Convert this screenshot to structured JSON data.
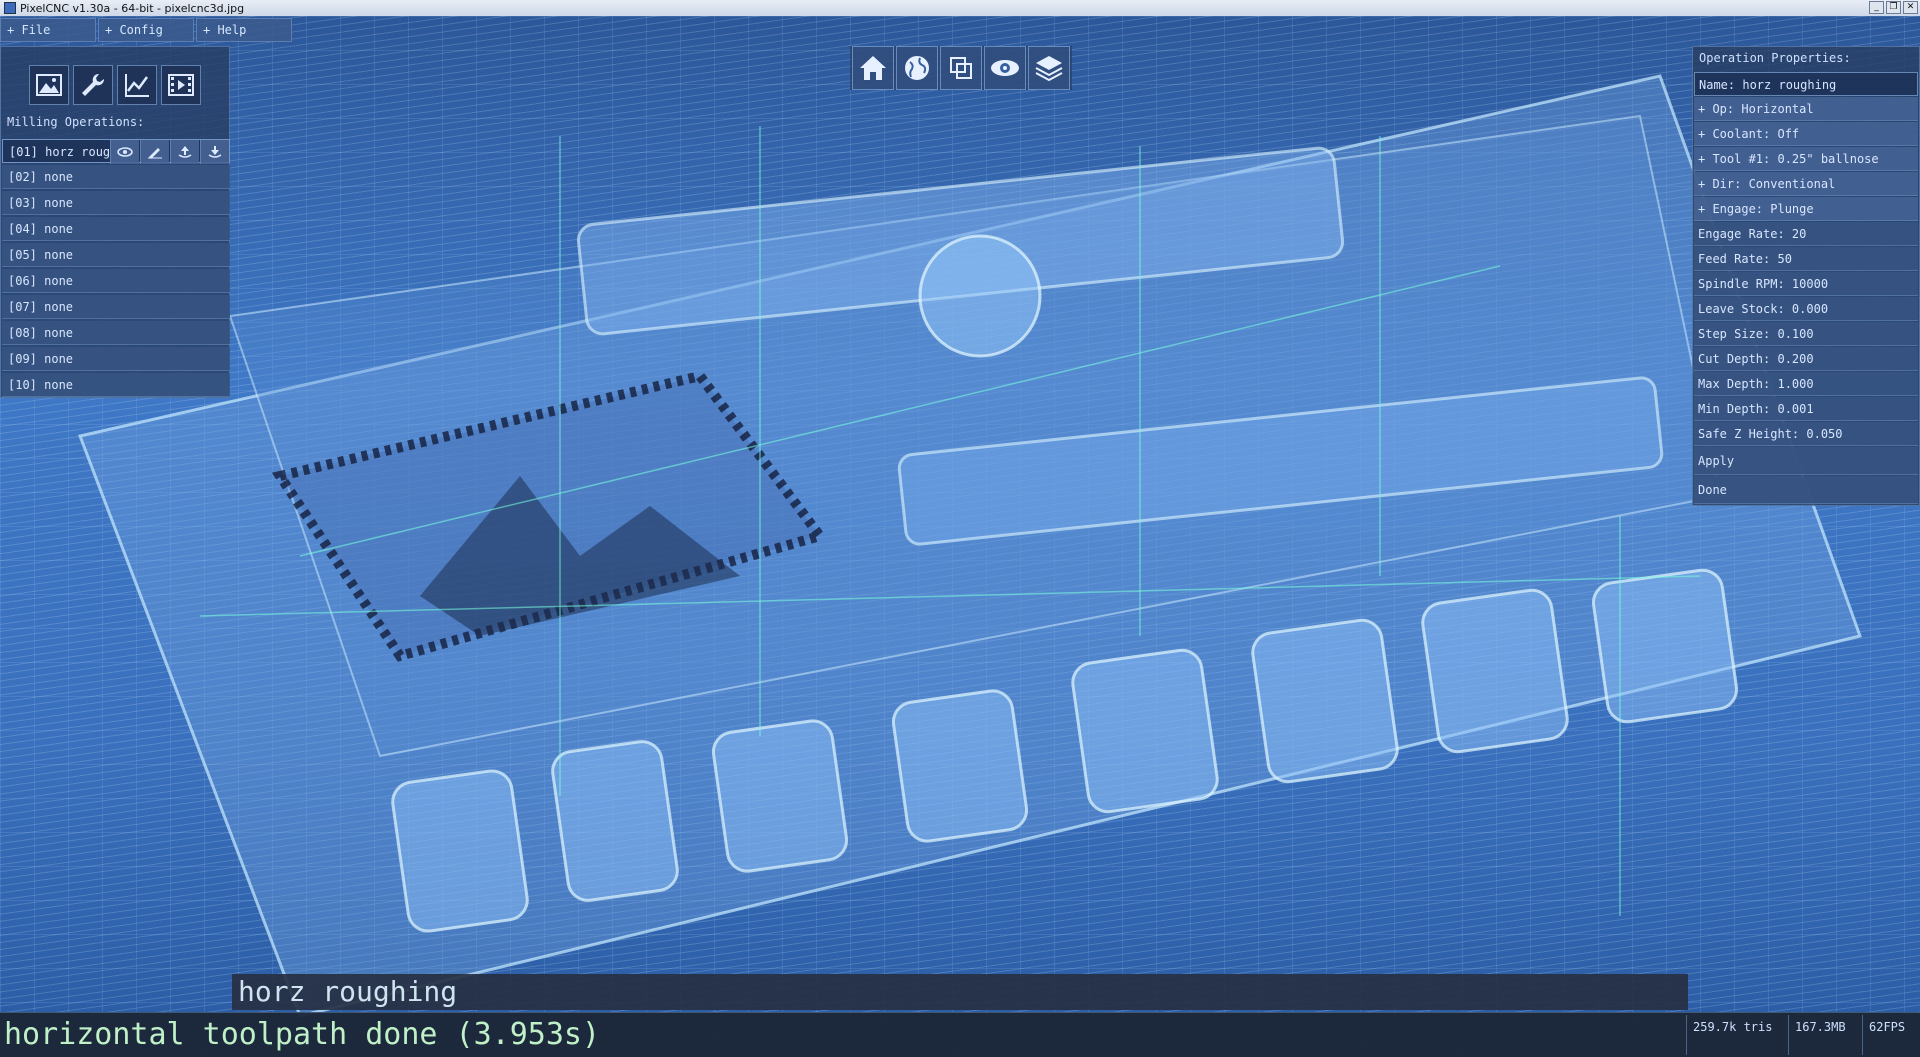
{
  "window": {
    "title": "PixelCNC v1.30a - 64-bit - pixelcnc3d.jpg",
    "controls": {
      "minimize": "_",
      "restore": "❐",
      "close": "✕"
    }
  },
  "menu": {
    "items": [
      "+ File",
      "+ Config",
      "+ Help"
    ]
  },
  "left_panel": {
    "tools": [
      "image-icon",
      "wrench-icon",
      "chart-icon",
      "film-icon"
    ],
    "ops_title": "Milling Operations:",
    "operations": [
      "[01] horz roug",
      "[02] none",
      "[03] none",
      "[04] none",
      "[05] none",
      "[06] none",
      "[07] none",
      "[08] none",
      "[09] none",
      "[10] none"
    ],
    "selected_op_icons": [
      "eye-icon",
      "edit-icon",
      "tool-in-icon",
      "tool-out-icon"
    ]
  },
  "view_toolbar": {
    "buttons": [
      "home-icon",
      "globe-icon",
      "copy-icon",
      "eye-icon",
      "layers-icon"
    ]
  },
  "properties": {
    "title": "Operation Properties:",
    "name": "Name: horz roughing",
    "rows": [
      "+ Op: Horizontal",
      "+ Coolant: Off",
      "+ Tool #1: 0.25\" ballnose",
      "+ Dir: Conventional",
      "+ Engage: Plunge",
      "Engage Rate: 20",
      "Feed Rate: 50",
      "Spindle RPM: 10000",
      "Leave Stock: 0.000",
      "Step Size: 0.100",
      "Cut Depth: 0.200",
      "Max Depth: 1.000",
      "Min Depth: 0.001",
      "Safe Z Height: 0.050"
    ],
    "apply": "Apply",
    "done": "Done"
  },
  "name_bar": "horz roughing",
  "status": {
    "message": "horizontal toolpath done (3.953s)",
    "tris": "259.7k tris",
    "memory": "167.3MB",
    "fps": "62FPS"
  },
  "colors": {
    "accent": "#3f78c6",
    "status_text": "#bff0c8",
    "panel": "#283e64"
  }
}
